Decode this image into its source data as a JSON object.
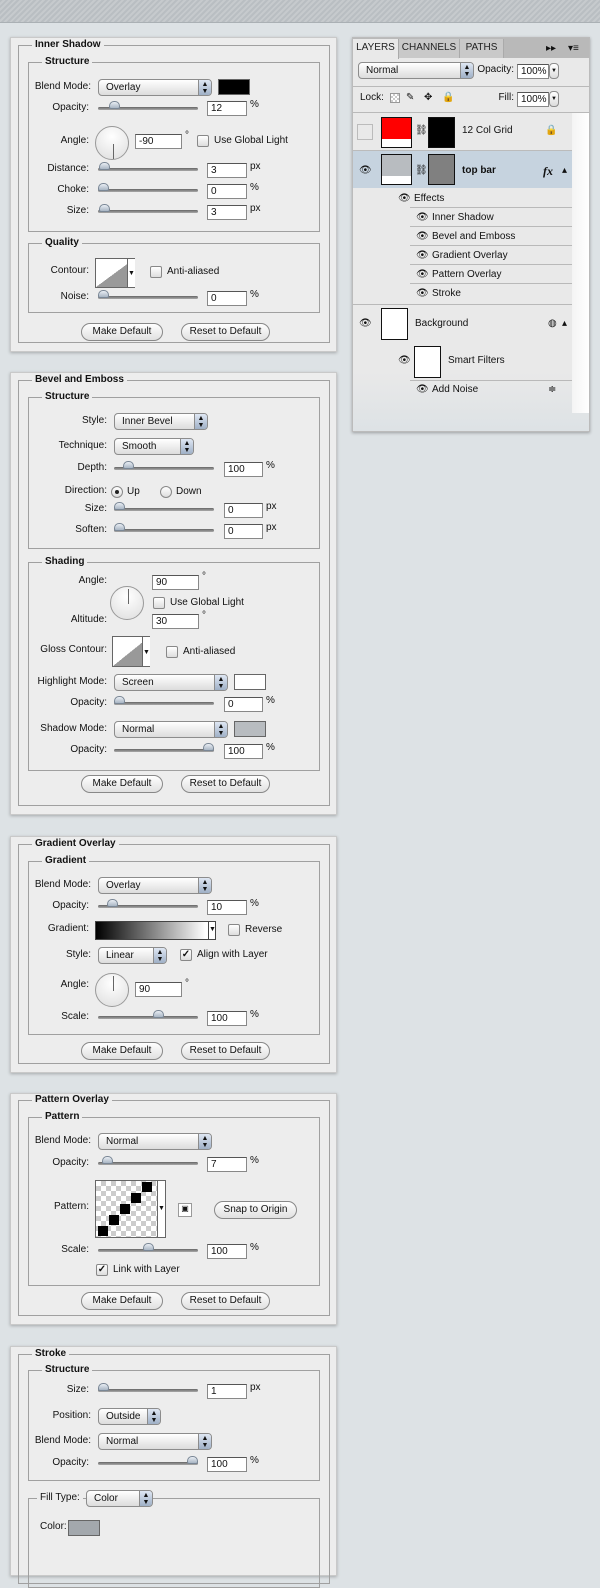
{
  "inner_shadow": {
    "title": "Inner Shadow",
    "structure_title": "Structure",
    "blend_mode_label": "Blend Mode:",
    "blend_mode": "Overlay",
    "color": "#000000",
    "opacity_label": "Opacity:",
    "opacity": "12",
    "opacity_fraction": 0.12,
    "angle_label": "Angle:",
    "angle": "-90",
    "angle_unit": "°",
    "use_global_light": "Use Global Light",
    "use_global_light_checked": false,
    "distance_label": "Distance:",
    "distance": "3",
    "distance_unit": "px",
    "choke_label": "Choke:",
    "choke": "0",
    "choke_unit": "%",
    "size_label": "Size:",
    "size": "3",
    "size_unit": "px",
    "quality_title": "Quality",
    "contour_label": "Contour:",
    "anti_aliased": "Anti-aliased",
    "anti_aliased_checked": false,
    "noise_label": "Noise:",
    "noise": "0",
    "noise_unit": "%",
    "pct": "%",
    "make_default": "Make Default",
    "reset_default": "Reset to Default"
  },
  "bevel_emboss": {
    "title": "Bevel and Emboss",
    "structure_title": "Structure",
    "style_label": "Style:",
    "style": "Inner Bevel",
    "technique_label": "Technique:",
    "technique": "Smooth",
    "depth_label": "Depth:",
    "depth": "100",
    "depth_unit": "%",
    "direction_label": "Direction:",
    "direction_up": "Up",
    "direction_down": "Down",
    "direction": "Up",
    "size_label": "Size:",
    "size": "0",
    "size_unit": "px",
    "soften_label": "Soften:",
    "soften": "0",
    "soften_unit": "px",
    "shading_title": "Shading",
    "angle_label": "Angle:",
    "angle": "90",
    "angle_unit": "°",
    "use_global_light": "Use Global Light",
    "use_global_light_checked": false,
    "altitude_label": "Altitude:",
    "altitude": "30",
    "altitude_unit": "°",
    "gloss_contour_label": "Gloss Contour:",
    "anti_aliased": "Anti-aliased",
    "anti_aliased_checked": false,
    "highlight_mode_label": "Highlight Mode:",
    "highlight_mode": "Screen",
    "highlight_color": "#ffffff",
    "highlight_opacity_label": "Opacity:",
    "highlight_opacity": "0",
    "highlight_opacity_unit": "%",
    "shadow_mode_label": "Shadow Mode:",
    "shadow_mode": "Normal",
    "shadow_color": "#b8bcc0",
    "shadow_opacity_label": "Opacity:",
    "shadow_opacity": "100",
    "shadow_opacity_unit": "%",
    "make_default": "Make Default",
    "reset_default": "Reset to Default"
  },
  "gradient_overlay": {
    "title": "Gradient Overlay",
    "gradient_title": "Gradient",
    "blend_mode_label": "Blend Mode:",
    "blend_mode": "Overlay",
    "opacity_label": "Opacity:",
    "opacity": "10",
    "opacity_unit": "%",
    "gradient_label": "Gradient:",
    "reverse": "Reverse",
    "reverse_checked": false,
    "style_label": "Style:",
    "style": "Linear",
    "align_with_layer": "Align with Layer",
    "align_with_layer_checked": true,
    "angle_label": "Angle:",
    "angle": "90",
    "angle_unit": "°",
    "scale_label": "Scale:",
    "scale": "100",
    "scale_unit": "%",
    "make_default": "Make Default",
    "reset_default": "Reset to Default"
  },
  "pattern_overlay": {
    "title": "Pattern Overlay",
    "pattern_title": "Pattern",
    "blend_mode_label": "Blend Mode:",
    "blend_mode": "Normal",
    "opacity_label": "Opacity:",
    "opacity": "7",
    "opacity_unit": "%",
    "pattern_label": "Pattern:",
    "snap_to_origin": "Snap to Origin",
    "scale_label": "Scale:",
    "scale": "100",
    "scale_unit": "%",
    "link_with_layer": "Link with Layer",
    "link_with_layer_checked": true,
    "make_default": "Make Default",
    "reset_default": "Reset to Default"
  },
  "stroke": {
    "title": "Stroke",
    "structure_title": "Structure",
    "size_label": "Size:",
    "size": "1",
    "size_unit": "px",
    "position_label": "Position:",
    "position": "Outside",
    "blend_mode_label": "Blend Mode:",
    "blend_mode": "Normal",
    "opacity_label": "Opacity:",
    "opacity": "100",
    "opacity_unit": "%",
    "fill_type_label": "Fill Type:",
    "fill_type": "Color",
    "color_label": "Color:",
    "color": "#a3a8ad"
  },
  "layers_panel": {
    "tabs": [
      "LAYERS",
      "CHANNELS",
      "PATHS"
    ],
    "active_tab": "LAYERS",
    "blend_mode": "Normal",
    "opacity_label": "Opacity:",
    "opacity": "100%",
    "lock_label": "Lock:",
    "fill_label": "Fill:",
    "fill": "100%",
    "layers": [
      {
        "name": "12 Col Grid",
        "visible": false,
        "locked": true,
        "thumb_color": "#ff0000",
        "mask_color": "#000000"
      },
      {
        "name": "top bar",
        "visible": true,
        "selected": true,
        "thumb_color": "#b8bcc0",
        "mask_color": "#808080",
        "fx": "fx"
      },
      {
        "name": "Background",
        "visible": true
      }
    ],
    "effects_label": "Effects",
    "effects": [
      "Inner Shadow",
      "Bevel and Emboss",
      "Gradient Overlay",
      "Pattern Overlay",
      "Stroke"
    ],
    "smart_filters_label": "Smart Filters",
    "filters": [
      "Add Noise"
    ]
  }
}
